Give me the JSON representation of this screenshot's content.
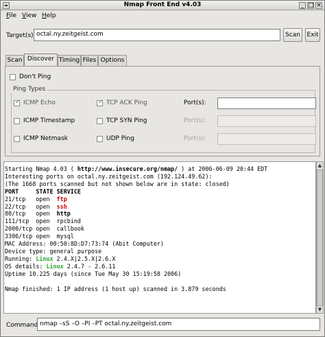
{
  "window": {
    "title": "Nmap Front End v4.03",
    "title_button_glyphs": [
      "_",
      "□",
      "×"
    ]
  },
  "menu": {
    "file": {
      "mnemonic": "F",
      "rest": "ile"
    },
    "view": {
      "mnemonic": "V",
      "rest": "iew"
    },
    "help": {
      "mnemonic": "H",
      "rest": "elp"
    }
  },
  "target": {
    "label": "Target(s):",
    "value": "octal.ny.zeitgeist.com",
    "scan_label": "Scan",
    "exit_label": "Exit"
  },
  "tabs": [
    "Scan",
    "Discover",
    "Timing",
    "Files",
    "Options"
  ],
  "active_tab": "Discover",
  "discover": {
    "dont_ping": {
      "label": "Don't Ping",
      "checked": false
    },
    "ping_types_title": "Ping Types",
    "options": [
      {
        "label": "ICMP Echo",
        "checked": true
      },
      {
        "label": "TCP ACK Ping",
        "checked": true
      },
      {
        "label": "ICMP Timestamp",
        "checked": false
      },
      {
        "label": "TCP SYN Ping",
        "checked": false
      },
      {
        "label": "ICMP Netmask",
        "checked": false
      },
      {
        "label": "UDP Ping",
        "checked": false
      }
    ],
    "ports_label": "Port(s):",
    "check_glyph": "✓"
  },
  "output": {
    "lines": [
      {
        "segments": [
          {
            "t": "Starting Nmap 4.03 ( "
          },
          {
            "t": "http://www.insecure.org/nmap/",
            "s": "b"
          },
          {
            "t": " ) at 2006-06-09 20:44 EDT"
          }
        ]
      },
      {
        "segments": [
          {
            "t": "Interesting ports on octal.ny.zeitgeist.com (192.124.49.62):"
          }
        ]
      },
      {
        "segments": [
          {
            "t": "(The 1668 ports scanned but not shown below are in state: closed)"
          }
        ]
      },
      {
        "segments": [
          {
            "t": "PORT     STATE SERVICE",
            "s": "b"
          }
        ]
      },
      {
        "segments": [
          {
            "t": "21/tcp   open  "
          },
          {
            "t": "ftp",
            "s": "red"
          }
        ]
      },
      {
        "segments": [
          {
            "t": "22/tcp   open  "
          },
          {
            "t": "ssh",
            "s": "red"
          }
        ]
      },
      {
        "segments": [
          {
            "t": "80/tcp   open  "
          },
          {
            "t": "http",
            "s": "b"
          }
        ]
      },
      {
        "segments": [
          {
            "t": "111/tcp  open  rpcbind"
          }
        ]
      },
      {
        "segments": [
          {
            "t": "2000/tcp open  callbook"
          }
        ]
      },
      {
        "segments": [
          {
            "t": "3306/tcp open  mysql"
          }
        ]
      },
      {
        "segments": [
          {
            "t": "MAC Address: 00:50:8D:D7:73:74 (Abit Computer)"
          }
        ]
      },
      {
        "segments": [
          {
            "t": "Device type: general purpose"
          }
        ]
      },
      {
        "segments": [
          {
            "t": "Running: "
          },
          {
            "t": "Linux",
            "s": "green"
          },
          {
            "t": " 2.4.X|2.5.X|2.6.X"
          }
        ]
      },
      {
        "segments": [
          {
            "t": "OS details: "
          },
          {
            "t": "Linux",
            "s": "green"
          },
          {
            "t": " 2.4.7 - 2.6.11"
          }
        ]
      },
      {
        "segments": [
          {
            "t": "Uptime 10.225 days (since Tue May 30 15:19:58 2006)"
          }
        ]
      },
      {
        "segments": [
          {
            "t": ""
          }
        ]
      },
      {
        "segments": [
          {
            "t": "Nmap finished: 1 IP address (1 host up) scanned in 3.879 seconds"
          }
        ]
      }
    ]
  },
  "command": {
    "label": "Command:",
    "value": "nmap –sS –O –PI –PT octal.ny.zeitgeist.com"
  },
  "colors": {
    "port_service_red": "#cc0000",
    "os_green": "#2ea32e",
    "window_bg": "#e8e6e3"
  }
}
